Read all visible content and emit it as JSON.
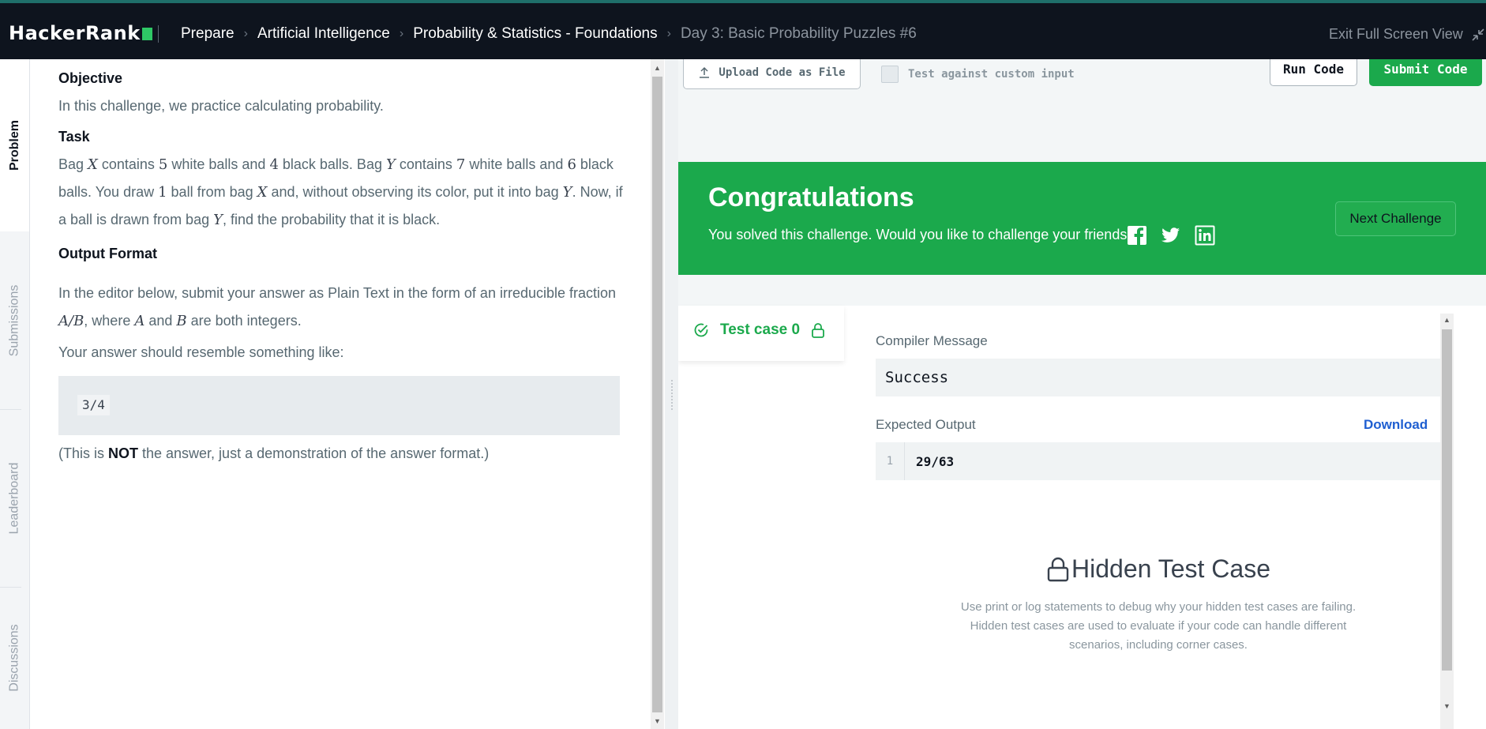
{
  "header": {
    "logo_text": "HackerRank",
    "breadcrumbs": [
      "Prepare",
      "Artificial Intelligence",
      "Probability & Statistics - Foundations"
    ],
    "current_page": "Day 3: Basic Probability Puzzles #6",
    "exit_fullscreen_label": "Exit Full Screen View"
  },
  "side_tabs": [
    "Problem",
    "Submissions",
    "Leaderboard",
    "Discussions"
  ],
  "problem": {
    "objective_heading": "Objective",
    "objective_text": "In this challenge, we practice calculating probability.",
    "task_heading": "Task",
    "task": {
      "t1": "Bag ",
      "v1": "X",
      "t2": " contains ",
      "n1": "5",
      "t3": " white balls and ",
      "n2": "4",
      "t4": " black balls. Bag ",
      "v2": "Y",
      "t5": " contains ",
      "n3": "7",
      "t6": " white balls and ",
      "n4": "6",
      "t7": " black balls. You draw ",
      "n5": "1",
      "t8": " ball from bag ",
      "v3": "X",
      "t9": " and, without observing its color, put it into bag ",
      "v4": "Y",
      "t10": ". Now, if a ball is drawn from bag ",
      "v5": "Y",
      "t11": ", find the probability that it is black."
    },
    "output_heading": "Output Format",
    "output": {
      "t1": "In the editor below, submit your answer as Plain Text in the form of an irreducible fraction ",
      "v1": "A/B",
      "t2": ", where ",
      "v2": "A",
      "t3": " and ",
      "v3": "B",
      "t4": " are both integers."
    },
    "resemble_text": "Your answer should resemble something like:",
    "example_code": "3/4",
    "note": {
      "t1": "(This is ",
      "bold": "NOT",
      "t2": " the answer, just a demonstration of the answer format.)"
    }
  },
  "editor_toolbar": {
    "upload_label": "Upload Code as File",
    "custom_input_label": "Test against custom input",
    "run_label": "Run Code",
    "submit_label": "Submit Code"
  },
  "congrats": {
    "title": "Congratulations",
    "message": "You solved this challenge. Would you like to challenge your friends?",
    "next_label": "Next Challenge",
    "social_icons": [
      "facebook-icon",
      "twitter-icon",
      "linkedin-icon"
    ]
  },
  "results": {
    "test_case_label": "Test case 0",
    "compiler_message_label": "Compiler Message",
    "compiler_message": "Success",
    "expected_output_label": "Expected Output",
    "download_label": "Download",
    "expected_line_number": "1",
    "expected_output": "29/63",
    "hidden_title": "Hidden Test Case",
    "hidden_desc": "Use print or log statements to debug why your hidden test cases are failing. Hidden test cases are used to evaluate if your code can handle different scenarios, including corner cases."
  },
  "colors": {
    "brand_green": "#1ba94c",
    "nav_bg": "#0e141e",
    "link_blue": "#1f5fd1"
  }
}
